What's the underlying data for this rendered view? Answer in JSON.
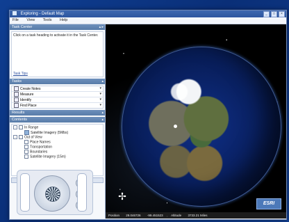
{
  "window": {
    "title": "Exploring - Default Map"
  },
  "menu": [
    "File",
    "View",
    "Tools",
    "Help"
  ],
  "task_center": {
    "header": "Task Center",
    "message": "Click on a task heading to activate it in the Task Center.",
    "tips_label": "Task Tips"
  },
  "tasks": {
    "header": "Tasks",
    "items": [
      "Create Notes",
      "Measure",
      "Identify",
      "Find Place"
    ]
  },
  "results": {
    "header": "Results"
  },
  "contents": {
    "header": "Contents",
    "items": [
      {
        "label": "In Range",
        "level": 1,
        "type": "group"
      },
      {
        "label": "Satellite Imagery (5Mbs)",
        "level": 2,
        "type": "layer"
      },
      {
        "label": "Out of View",
        "level": 1,
        "type": "group"
      },
      {
        "label": "Place Names",
        "level": 2,
        "type": "layer"
      },
      {
        "label": "Transportation",
        "level": 2,
        "type": "layer"
      },
      {
        "label": "Boundaries",
        "level": 2,
        "type": "layer"
      },
      {
        "label": "Satellite Imagery (15m)",
        "level": 2,
        "type": "layer"
      }
    ]
  },
  "map": {
    "logo_text": "ESRI",
    "status": {
      "position_label": "Position",
      "position_value": "29.046726",
      "longitude_value": "-99.451523",
      "altitude_label": "Altitude",
      "altitude_value": "3733.21 Miles"
    }
  },
  "navigation": {
    "scroll_arrow": "▼",
    "nav_icons": [
      "⊕",
      "⊖",
      "⟲"
    ]
  },
  "colors": {
    "window_blue": "#2d559f",
    "panel_header": "#587ca9",
    "ocean": "#0f2f88"
  }
}
